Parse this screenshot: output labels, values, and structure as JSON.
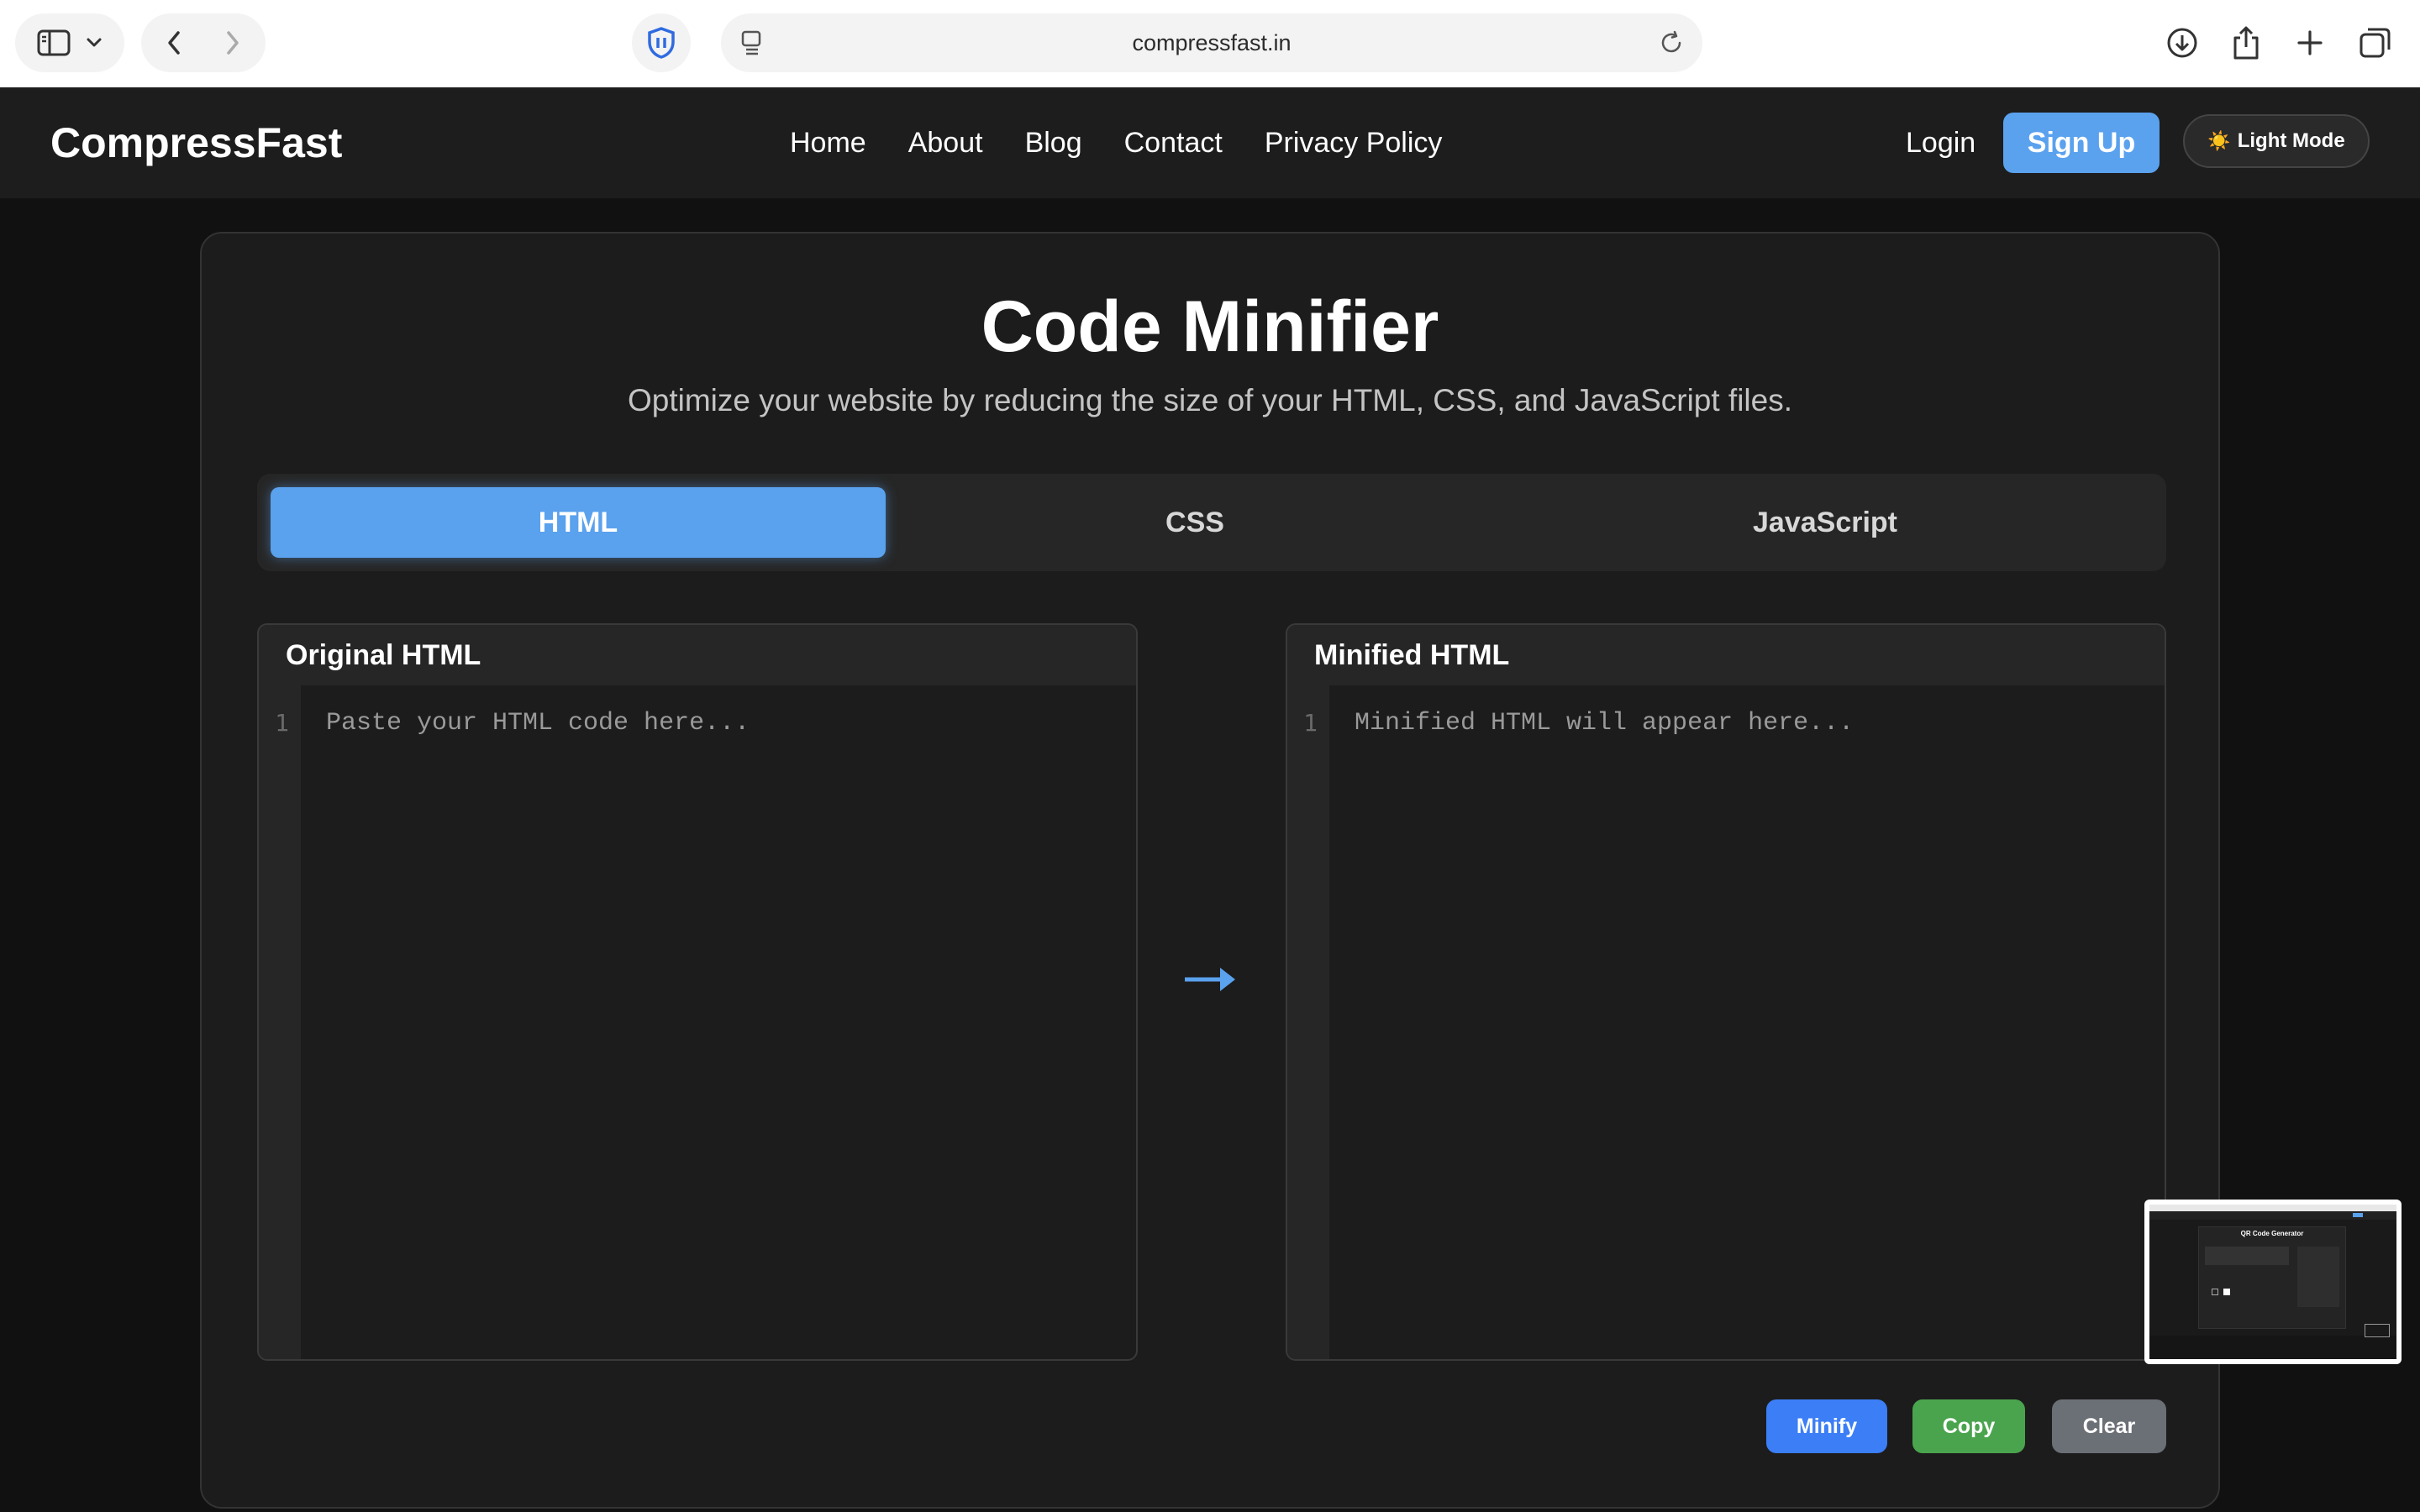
{
  "browser": {
    "url": "compressfast.in",
    "icons": [
      "sidebar-icon",
      "chevron-down-icon",
      "back-icon",
      "forward-icon",
      "privacy-shield-icon",
      "reader-icon",
      "reload-icon",
      "download-icon",
      "share-icon",
      "new-tab-icon",
      "tab-overview-icon"
    ]
  },
  "nav": {
    "brand": "CompressFast",
    "links": [
      "Home",
      "About",
      "Blog",
      "Contact",
      "Privacy Policy"
    ],
    "login": "Login",
    "signup": "Sign Up",
    "light_mode_icon": "☀️",
    "light_mode": "Light Mode"
  },
  "main": {
    "title": "Code Minifier",
    "subtitle": "Optimize your website by reducing the size of your HTML, CSS, and JavaScript files.",
    "tabs": [
      {
        "label": "HTML",
        "active": true
      },
      {
        "label": "CSS",
        "active": false
      },
      {
        "label": "JavaScript",
        "active": false
      }
    ],
    "input_editor": {
      "header": "Original HTML",
      "line_number": "1",
      "placeholder": "Paste your HTML code here..."
    },
    "output_editor": {
      "header": "Minified HTML",
      "line_number": "1",
      "placeholder": "Minified HTML will appear here..."
    },
    "buttons": {
      "minify": "Minify",
      "copy": "Copy",
      "clear": "Clear"
    }
  },
  "thumbnail": {
    "title": "QR Code Generator"
  },
  "colors": {
    "accent": "#5aa1ee",
    "minify": "#3b7ef6",
    "copy": "#4aa44e",
    "clear": "#6b6f76",
    "page_bg": "#111111",
    "card_bg": "#1c1c1c"
  }
}
